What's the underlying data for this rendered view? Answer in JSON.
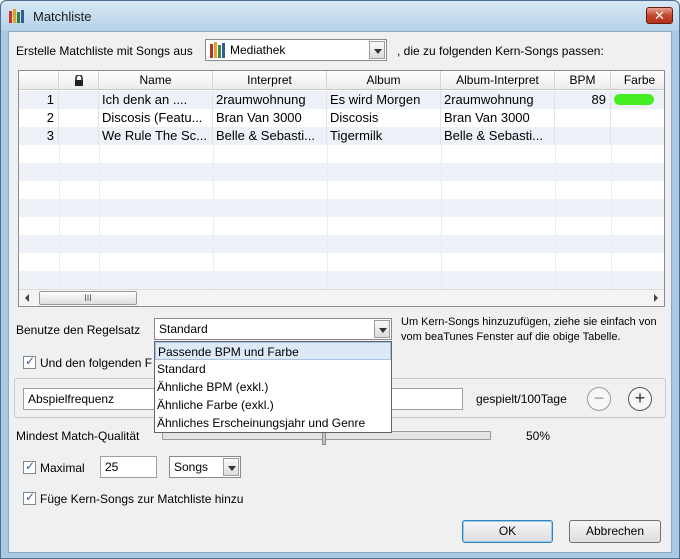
{
  "window": {
    "title": "Matchliste"
  },
  "source": {
    "prefix": "Erstelle Matchliste mit Songs aus",
    "value": "Mediathek",
    "suffix": ", die zu folgenden Kern-Songs passen:"
  },
  "table": {
    "columns": [
      "",
      "",
      "Name",
      "Interpret",
      "Album",
      "Album-Interpret",
      "BPM",
      "Farbe"
    ],
    "rows": [
      {
        "n": "1",
        "name": "Ich denk an ....",
        "artist": "2raumwohnung",
        "album": "Es wird Morgen",
        "album_artist": "2raumwohnung",
        "bpm": "89",
        "color": "#44ee22"
      },
      {
        "n": "2",
        "name": "Discosis (Featu...",
        "artist": "Bran Van 3000",
        "album": "Discosis",
        "album_artist": "Bran Van 3000",
        "bpm": "",
        "color": ""
      },
      {
        "n": "3",
        "name": "We Rule The Sc...",
        "artist": "Belle & Sebasti...",
        "album": "Tigermilk",
        "album_artist": "Belle & Sebasti...",
        "bpm": "",
        "color": ""
      }
    ],
    "scroll_grip": "III"
  },
  "ruleset": {
    "label": "Benutze den Regelsatz",
    "value": "Standard",
    "hint": "Um Kern-Songs hinzuzufügen, ziehe sie einfach von vom beaTunes Fenster auf die obige Tabelle.",
    "options": [
      "Passende BPM und Farbe",
      "Standard",
      "Ähnliche BPM (exkl.)",
      "Ähnliche Farbe (exkl.)",
      "Ähnliches Erscheinungsjahr und Genre"
    ]
  },
  "filter": {
    "checkbox_label": "Und den folgenden F",
    "field_value": "Abspielfrequenz",
    "unit": "gespielt/100Tage",
    "minus": "−",
    "plus": "+"
  },
  "quality": {
    "label": "Mindest Match-Qualität",
    "value": "50%",
    "fraction": 0.5
  },
  "maximal": {
    "label": "Maximal",
    "count": "25",
    "unit": "Songs"
  },
  "add_core": {
    "label": "Füge Kern-Songs zur Matchliste hinzu"
  },
  "buttons": {
    "ok": "OK",
    "cancel": "Abbrechen",
    "close": "✕"
  },
  "colors": {
    "accent": "#3c7fb1",
    "highlight": "#dde9f6"
  }
}
